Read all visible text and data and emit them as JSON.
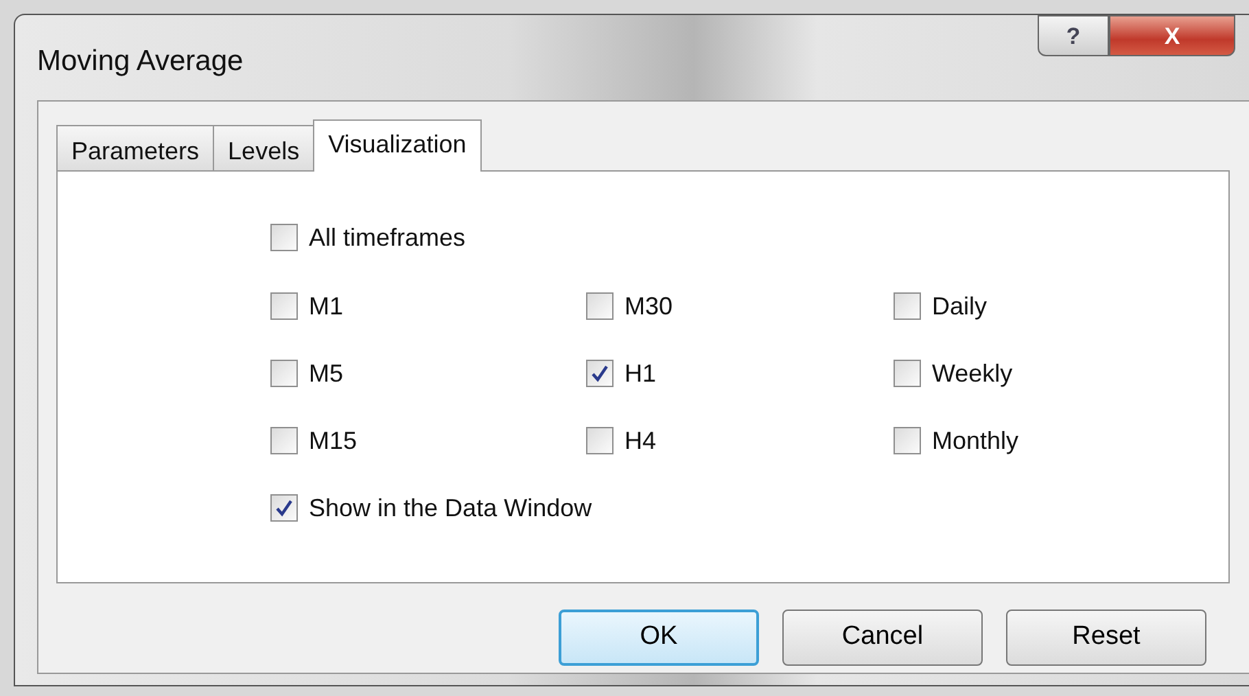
{
  "window": {
    "title": "Moving Average",
    "help_button": "?",
    "close_button": "X"
  },
  "tabs": [
    {
      "label": "Parameters",
      "selected": false
    },
    {
      "label": "Levels",
      "selected": false
    },
    {
      "label": "Visualization",
      "selected": true
    }
  ],
  "all_timeframes": {
    "label": "All timeframes",
    "checked": false
  },
  "timeframe_columns": [
    [
      {
        "label": "M1",
        "checked": false
      },
      {
        "label": "M5",
        "checked": false
      },
      {
        "label": "M15",
        "checked": false
      }
    ],
    [
      {
        "label": "M30",
        "checked": false
      },
      {
        "label": "H1",
        "checked": true
      },
      {
        "label": "H4",
        "checked": false
      }
    ],
    [
      {
        "label": "Daily",
        "checked": false
      },
      {
        "label": "Weekly",
        "checked": false
      },
      {
        "label": "Monthly",
        "checked": false
      }
    ]
  ],
  "show_in_data_window": {
    "label": "Show in the Data Window",
    "checked": true
  },
  "buttons": [
    {
      "label": "OK",
      "default": true
    },
    {
      "label": "Cancel",
      "default": false
    },
    {
      "label": "Reset",
      "default": false
    }
  ]
}
